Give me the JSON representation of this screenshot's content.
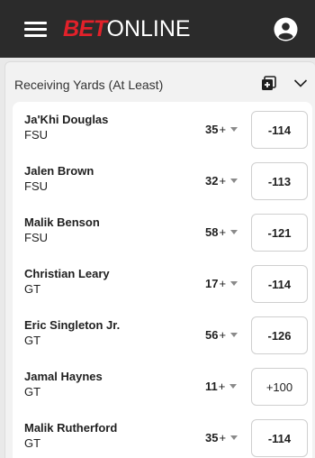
{
  "header": {
    "logo_bet": "BET",
    "logo_online": "ONLINE",
    "menu_icon": "hamburger-menu-icon",
    "account_icon": "user-account-icon"
  },
  "market": {
    "title": "Receiving Yards (At Least)",
    "add_icon": "add-to-betslip-icon",
    "collapse_icon": "chevron-down-icon"
  },
  "players": [
    {
      "name": "Ja'Khi Douglas",
      "team": "FSU",
      "line": "35",
      "plus": "+",
      "odds": "-114"
    },
    {
      "name": "Jalen Brown",
      "team": "FSU",
      "line": "32",
      "plus": "+",
      "odds": "-113"
    },
    {
      "name": "Malik Benson",
      "team": "FSU",
      "line": "58",
      "plus": "+",
      "odds": "-121"
    },
    {
      "name": "Christian Leary",
      "team": "GT",
      "line": "17",
      "plus": "+",
      "odds": "-114"
    },
    {
      "name": "Eric Singleton Jr.",
      "team": "GT",
      "line": "56",
      "plus": "+",
      "odds": "-126"
    },
    {
      "name": "Jamal Haynes",
      "team": "GT",
      "line": "11",
      "plus": "+",
      "odds": "+100"
    },
    {
      "name": "Malik Rutherford",
      "team": "GT",
      "line": "35",
      "plus": "+",
      "odds": "-114"
    }
  ],
  "colors": {
    "header_bg": "#2b2b2b",
    "brand_red": "#e2212a",
    "page_bg": "#e9e9e9"
  }
}
